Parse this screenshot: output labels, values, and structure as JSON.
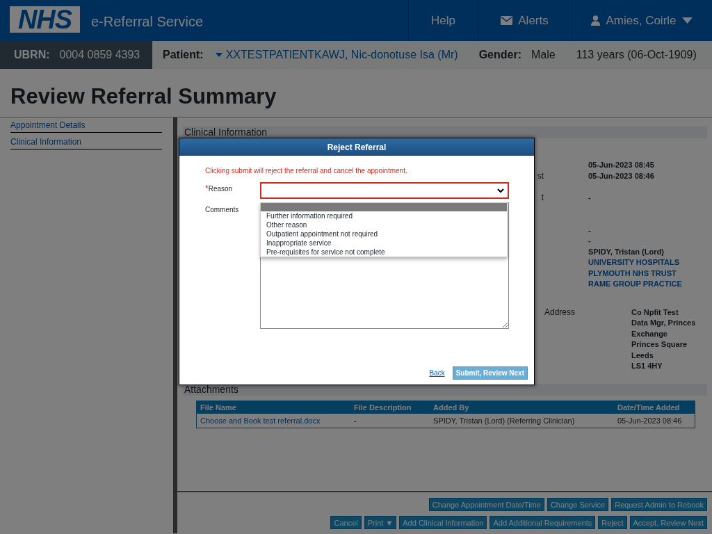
{
  "header": {
    "logo": "NHS",
    "service": "e-Referral Service",
    "nav": [
      {
        "kind": "link",
        "label": "Help"
      },
      {
        "kind": "alerts",
        "label": "Alerts"
      },
      {
        "kind": "user",
        "label": "Amies, Coirle"
      }
    ]
  },
  "patient_bar": {
    "ubrn_label": "UBRN:",
    "ubrn": "0004 0859 4393",
    "patient_label": "Patient:",
    "patient": "XXTESTPATIENTKAWJ, Nic-donotuse Isa (Mr)",
    "gender_label": "Gender:",
    "gender": "Male",
    "age": "113 years (06-Oct-1909)"
  },
  "page_title": "Review Referral Summary",
  "sidebar": {
    "items": [
      "Appointment Details",
      "Clinical Information"
    ]
  },
  "clinical_information": {
    "title": "Clinical Information",
    "groups": [
      {
        "rows": [
          {
            "kind": "text",
            "value": "05-Jun-2023 08:45"
          },
          {
            "kind": "text",
            "label": "st",
            "value": "05-Jun-2023 08:46"
          }
        ]
      },
      {
        "rows": [
          {
            "kind": "text",
            "label": "t",
            "value": "-"
          }
        ]
      },
      {
        "rows": [
          {
            "kind": "text",
            "value": "-"
          },
          {
            "kind": "text",
            "value": "-"
          },
          {
            "kind": "text",
            "value": "SPIDY, Tristan (Lord)"
          },
          {
            "kind": "link",
            "value": "UNIVERSITY HOSPITALS"
          },
          {
            "kind": "link",
            "value": "PLYMOUTH NHS TRUST"
          },
          {
            "kind": "link",
            "value": "RAME GROUP PRACTICE"
          }
        ]
      }
    ],
    "address": {
      "label": "Address",
      "lines": [
        "Co Npfit Test",
        "Data Mgr, Princes Exchange",
        "Princes Square",
        "Leeds",
        "LS1 4HY"
      ]
    }
  },
  "attachments": {
    "title": "Attachments",
    "columns": [
      "File Name",
      "File Description",
      "Added By",
      "Date/Time Added"
    ],
    "rows": [
      [
        "Choose and Book test referral.docx",
        "-",
        "SPIDY, Tristan (Lord) (Referring Clinician)",
        "05-Jun-2023 08:46"
      ]
    ]
  },
  "actions": [
    [
      "Change Appointment Date/Time",
      "Change Service",
      "Request Admin to Rebook"
    ],
    [
      "Cancel",
      "Print ▼",
      "Add Clinical Information",
      "Add Additional Requirements",
      "Reject",
      "Accept, Review Next"
    ]
  ],
  "dialog": {
    "title": "Reject Referral",
    "warning": "Clicking submit will reject the referral and cancel the appointment.",
    "reason": {
      "label": "Reason",
      "required": true,
      "required_mark": "*",
      "invalid": true,
      "open": true,
      "options": [
        {
          "label": "Further information required",
          "selected": false
        },
        {
          "label": "Other reason",
          "selected": false
        },
        {
          "label": "Outpatient appointment not required",
          "selected": false
        },
        {
          "label": "Inappropriate service",
          "selected": false
        },
        {
          "label": "Pre-requisites for service not complete",
          "selected": false
        }
      ]
    },
    "comments_label": "Comments",
    "back": "Back",
    "submit": "Submit, Review Next"
  }
}
